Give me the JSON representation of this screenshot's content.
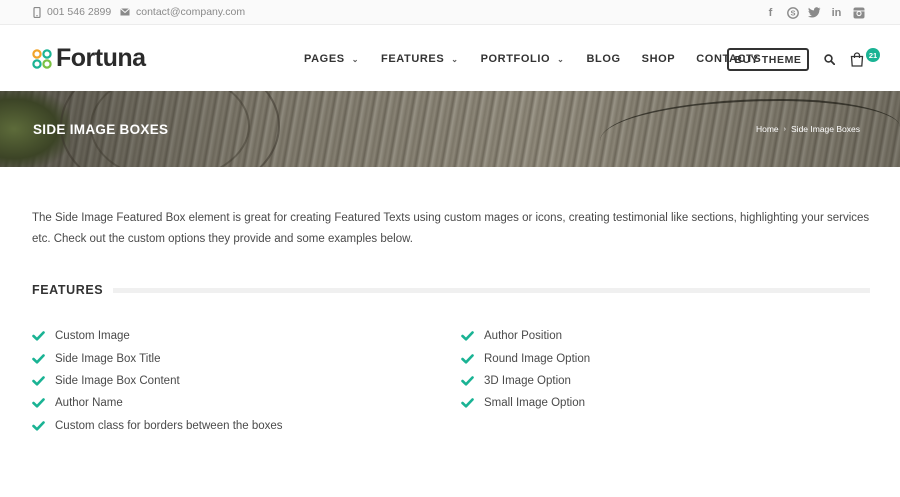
{
  "topbar": {
    "phone": "001 546 2899",
    "email": "contact@company.com",
    "socials": [
      {
        "name": "facebook-icon",
        "glyph": "f"
      },
      {
        "name": "skype-icon",
        "glyph": "S"
      },
      {
        "name": "twitter-icon",
        "glyph": "t"
      },
      {
        "name": "linkedin-icon",
        "glyph": "in"
      },
      {
        "name": "instagram-icon",
        "glyph": "◙"
      }
    ]
  },
  "header": {
    "logo_text": "Fortuna",
    "nav": [
      {
        "label": "PAGES",
        "dropdown": true
      },
      {
        "label": "FEATURES",
        "dropdown": true
      },
      {
        "label": "PORTFOLIO",
        "dropdown": true
      },
      {
        "label": "BLOG",
        "dropdown": false
      },
      {
        "label": "SHOP",
        "dropdown": false
      },
      {
        "label": "CONTACTS",
        "dropdown": false
      }
    ],
    "buy_label": "BUY THEME",
    "cart_count": "21",
    "accent": "#1ab394"
  },
  "banner": {
    "title": "SIDE IMAGE BOXES",
    "breadcrumb_home": "Home",
    "breadcrumb_current": "Side Image Boxes"
  },
  "content": {
    "intro": "The Side Image Featured Box element is great for creating Featured Texts using custom mages or icons, creating testimonial like sections, highlighting your services etc. Check out the custom options they provide and some examples below.",
    "features_title": "FEATURES",
    "features_left": [
      "Custom Image",
      "Side Image Box Title",
      "Side Image Box Content",
      "Author Name",
      "Custom class for borders between the boxes"
    ],
    "features_right": [
      "Author Position",
      "Round Image Option",
      "3D Image Option",
      "Small Image Option"
    ]
  }
}
